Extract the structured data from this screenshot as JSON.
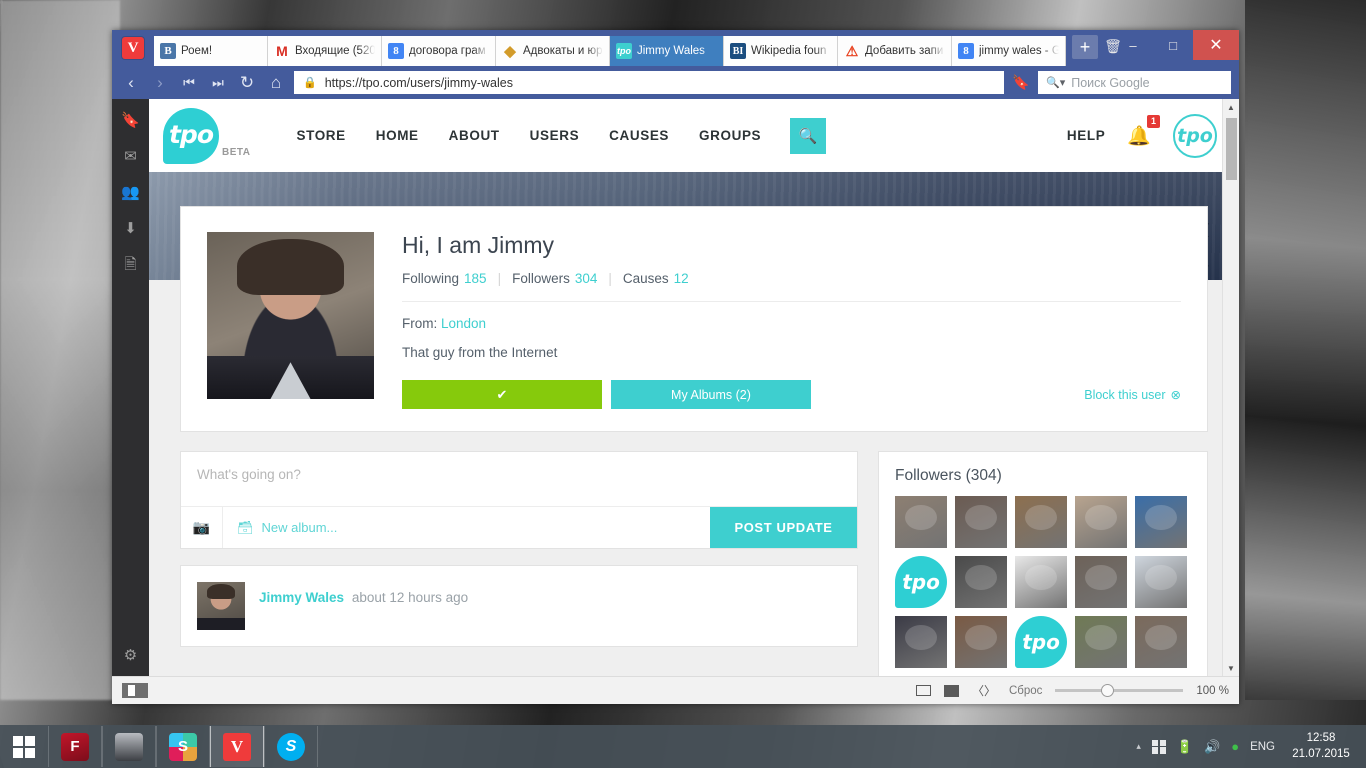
{
  "browser": {
    "app_icon": "vivaldi-logo",
    "tabs": [
      {
        "title": "Роем!",
        "favicon": "vk-icon",
        "fav_text": "B",
        "active": false
      },
      {
        "title": "Входящие (520",
        "favicon": "gmail-icon",
        "fav_text": "M",
        "active": false
      },
      {
        "title": "договора грам",
        "favicon": "google-icon",
        "fav_text": "8",
        "active": false
      },
      {
        "title": "Адвокаты и юр",
        "favicon": "shield-icon",
        "fav_text": "◆",
        "active": false
      },
      {
        "title": "Jimmy Wales",
        "favicon": "tpo-icon",
        "fav_text": "tpo",
        "active": true
      },
      {
        "title": "Wikipedia foun",
        "favicon": "bi-icon",
        "fav_text": "BI",
        "active": false
      },
      {
        "title": "Добавить запи",
        "favicon": "warning-icon",
        "fav_text": "⚠",
        "active": false
      },
      {
        "title": "jimmy wales - G",
        "favicon": "google-icon",
        "fav_text": "8",
        "active": false
      }
    ],
    "tab_actions": {
      "new_tab": "+",
      "trash": "🗑"
    },
    "window_controls": {
      "minimize": "–",
      "maximize": "□",
      "close": "✕"
    },
    "nav": {
      "back": "‹",
      "forward": "›",
      "rewind": "⏮",
      "fastforward": "⏭",
      "reload": "↻",
      "home": "⌂"
    },
    "url": "https://tpo.com/users/jimmy-wales",
    "url_lock": "🔒",
    "search_placeholder": "Поиск Google",
    "panel_icons": [
      "bookmarks-icon",
      "mail-icon",
      "contacts-icon",
      "downloads-icon",
      "notes-icon",
      "settings-icon"
    ],
    "statusbar": {
      "reset_label": "Сброс",
      "zoom_value": "100 %",
      "tiling_icon": "page-tiling-icon",
      "images_icon": "images-toggle-icon",
      "devtools_icon": "developer-tools-icon"
    }
  },
  "site": {
    "logo_text": "tpo",
    "logo_beta": "BETA",
    "nav": [
      {
        "label": "STORE"
      },
      {
        "label": "HOME"
      },
      {
        "label": "ABOUT"
      },
      {
        "label": "USERS"
      },
      {
        "label": "CAUSES"
      },
      {
        "label": "GROUPS"
      }
    ],
    "search_icon": "search-icon",
    "help_label": "HELP",
    "notification_count": "1",
    "user_avatar_text": "tpo",
    "accent_teal": "#3ecfcf",
    "accent_green": "#86ca0c",
    "accent_red": "#e53935"
  },
  "profile": {
    "heading": "Hi, I am Jimmy",
    "stats": [
      {
        "label": "Following",
        "value": "185"
      },
      {
        "label": "Followers",
        "value": "304"
      },
      {
        "label": "Causes",
        "value": "12"
      }
    ],
    "from_label": "From:",
    "from_value": "London",
    "bio": "That guy from the Internet",
    "follow_button_icon": "✔",
    "albums_button": "My Albums (2)",
    "block_link": "Block this user",
    "block_icon": "⊗"
  },
  "composer": {
    "placeholder": "What's going on?",
    "camera_icon": "camera-icon",
    "album_icon": "album-icon",
    "album_label": "New album...",
    "post_button": "POST UPDATE"
  },
  "feed": [
    {
      "author": "Jimmy Wales",
      "time": "about 12 hours ago"
    }
  ],
  "followers_panel": {
    "title": "Followers (304)",
    "thumbs": [
      {
        "kind": "photo",
        "tone": "#8d7f72",
        "name": "follower-jimmy"
      },
      {
        "kind": "photo",
        "tone": "#6b5b52",
        "name": "follower-couple"
      },
      {
        "kind": "photo",
        "tone": "#8d6f4f",
        "name": "follower-sunset-dock"
      },
      {
        "kind": "photo",
        "tone": "#b8a48f",
        "name": "follower-smiling-man"
      },
      {
        "kind": "photo",
        "tone": "#3a6ea8",
        "name": "follower-colorful-hair"
      },
      {
        "kind": "tpo",
        "tone": "#2ecfd3",
        "name": "follower-tpo-default-1"
      },
      {
        "kind": "photo",
        "tone": "#4a4a4a",
        "name": "follower-bw-portrait"
      },
      {
        "kind": "photo",
        "tone": "#e8e8e8",
        "name": "follower-lego-figure"
      },
      {
        "kind": "photo",
        "tone": "#6d6259",
        "name": "follower-bearded-man"
      },
      {
        "kind": "photo",
        "tone": "#cfd6de",
        "name": "follower-winter-couple"
      },
      {
        "kind": "photo",
        "tone": "#3b3b46",
        "name": "follower-city-night"
      },
      {
        "kind": "photo",
        "tone": "#7a5a44",
        "name": "follower-woman-indoor"
      },
      {
        "kind": "tpo",
        "tone": "#2ecfd3",
        "name": "follower-tpo-default-2"
      },
      {
        "kind": "photo",
        "tone": "#6f7a55",
        "name": "follower-blonde-woman"
      },
      {
        "kind": "photo",
        "tone": "#7b6a5c",
        "name": "follower-group-selfie"
      }
    ]
  },
  "taskbar": {
    "start_icon": "windows-start-icon",
    "apps": [
      {
        "name": "foxit-reader",
        "label": "F",
        "cls": "foxit",
        "active": false
      },
      {
        "name": "scanner-app",
        "label": "",
        "cls": "scan",
        "active": false
      },
      {
        "name": "slack",
        "label": "S",
        "cls": "slack",
        "active": false
      },
      {
        "name": "vivaldi-browser",
        "label": "V",
        "cls": "vivaldi",
        "active": true
      },
      {
        "name": "skype",
        "label": "S",
        "cls": "skype",
        "active": false
      }
    ],
    "tray": {
      "caret": "▴",
      "network_icon": "network-icon",
      "volume_icon": "🔊",
      "antivirus_icon": "antivirus-icon",
      "language": "ENG"
    },
    "time": "12:58",
    "date": "21.07.2015"
  }
}
